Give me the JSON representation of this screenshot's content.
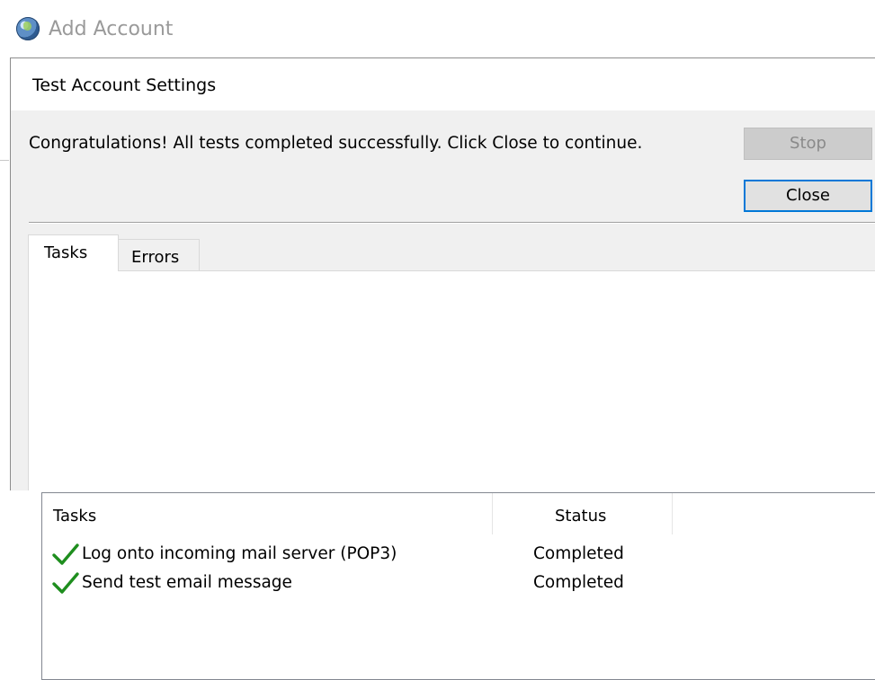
{
  "background_window": {
    "title": "Add Account",
    "icon": "globe-icon"
  },
  "dialog": {
    "title": "Test Account Settings",
    "message": "Congratulations! All tests completed successfully. Click Close to continue.",
    "buttons": {
      "stop_label": "Stop",
      "close_label": "Close"
    },
    "tabs": [
      {
        "label": "Tasks",
        "selected": true
      },
      {
        "label": "Errors",
        "selected": false
      }
    ],
    "task_list": {
      "columns": [
        "Tasks",
        "Status"
      ],
      "rows": [
        {
          "icon": "checkmark-icon",
          "task": "Log onto incoming mail server (POP3)",
          "status": "Completed"
        },
        {
          "icon": "checkmark-icon",
          "task": "Send test email message",
          "status": "Completed"
        }
      ]
    }
  },
  "colors": {
    "check_green": "#1e8e1e",
    "focus_blue": "#0078d7",
    "dialog_bg": "#f0f0f0"
  }
}
